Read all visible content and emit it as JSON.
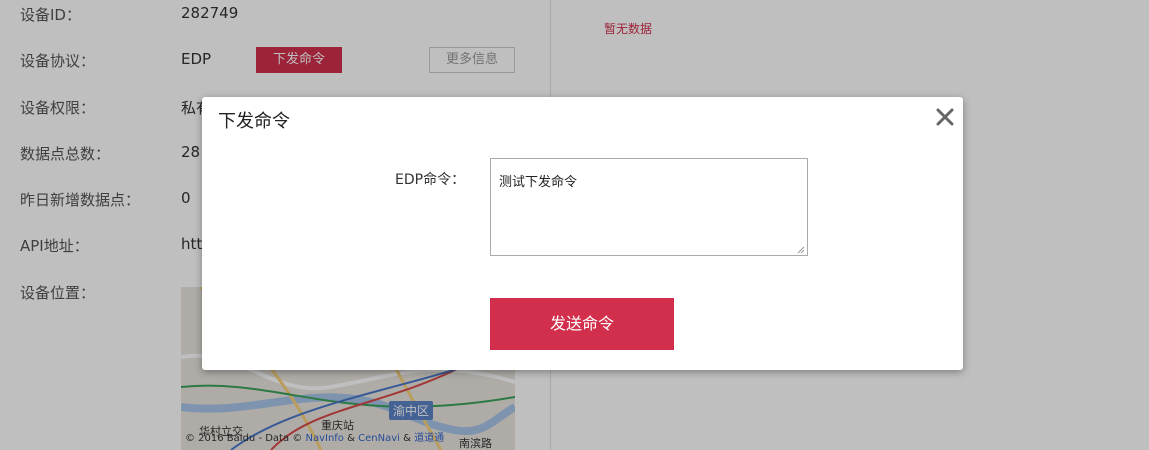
{
  "info": {
    "device_id_label": "设备ID：",
    "device_id_value": "282749",
    "protocol_label": "设备协议：",
    "protocol_value": "EDP",
    "send_cmd_button": "下发命令",
    "more_info_button": "更多信息",
    "permission_label": "设备权限：",
    "permission_value": "私有",
    "datapoints_total_label": "数据点总数：",
    "datapoints_total_value": "28",
    "yesterday_new_label": "昨日新增数据点：",
    "yesterday_new_value": "0",
    "api_label": "API地址：",
    "api_value": "htt",
    "location_label": "设备位置："
  },
  "right_panel": {
    "no_data": "暂无数据"
  },
  "map": {
    "credit_prefix": "© 2016 Baidu - Data ©",
    "credit_link1": "NavInfo",
    "credit_amp": "&",
    "credit_link2": "CenNavi",
    "credit_amp2": "&",
    "credit_link3": "道道通",
    "district_tag": "渝中区",
    "place1": "华村立交",
    "place2": "重庆站",
    "place3": "南滨路"
  },
  "modal": {
    "title": "下发命令",
    "field_label": "EDP命令：",
    "field_value": "测试下发命令",
    "send_button": "发送命令"
  },
  "colors": {
    "accent": "#d12f4b",
    "overlay": "rgba(0,0,0,0.25)"
  }
}
